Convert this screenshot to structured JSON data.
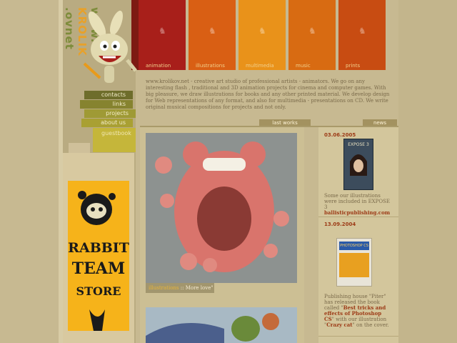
{
  "site": {
    "vertical_url_prefix": "www.",
    "vertical_brand": "KROLIK",
    "vertical_url_suffix": ".ovnet"
  },
  "tabs": [
    {
      "label": "animation"
    },
    {
      "label": "illustrations"
    },
    {
      "label": "multimedia"
    },
    {
      "label": "music"
    },
    {
      "label": "prints"
    }
  ],
  "nav": {
    "contacts": "contacts",
    "links": "links",
    "projects": "projects",
    "about": "about us",
    "guestbook": "guestbook"
  },
  "intro": "www.krolikov.net - creative art studio of professional artists - animators. We go on any interesting flash , traditional and 3D animation projects for cinema and computer games. With big pleasure, we draw illustrations for books and any other printed material. We develop design for Web representations of any format, and also for multimedia - presentations on CD. We write original musical compositions for projects and not only.",
  "sections": {
    "last_works": "last works",
    "news": "news"
  },
  "works": [
    {
      "caption_category": "illustrations",
      "caption_sep": " :: ",
      "caption_title": "More love\""
    }
  ],
  "store": {
    "line1": "RABBIT",
    "line2": "TEAM",
    "line3": "STORE"
  },
  "news": [
    {
      "date": "03.06.2005",
      "book_title": "EXPOSE 3",
      "text": "Some our illustrations were included in EXPOSE 3",
      "link": "ballisticpublishing.com"
    },
    {
      "date": "13.09.2004",
      "book_title": "PHOTOSHOP CS",
      "text_a": "Publishing house \"Piter\" has released the book called \"",
      "link_a": "Best tricks and effects of Photoshop CS",
      "text_b": "\" with our illustration \"",
      "link_b": "Crazy cat",
      "text_c": "\" on the cover."
    }
  ],
  "colors": {
    "accent_red": "#a81f1a",
    "accent_orange": "#d95f14",
    "store_yellow": "#f6b31a",
    "link_red": "#9c3a16"
  }
}
